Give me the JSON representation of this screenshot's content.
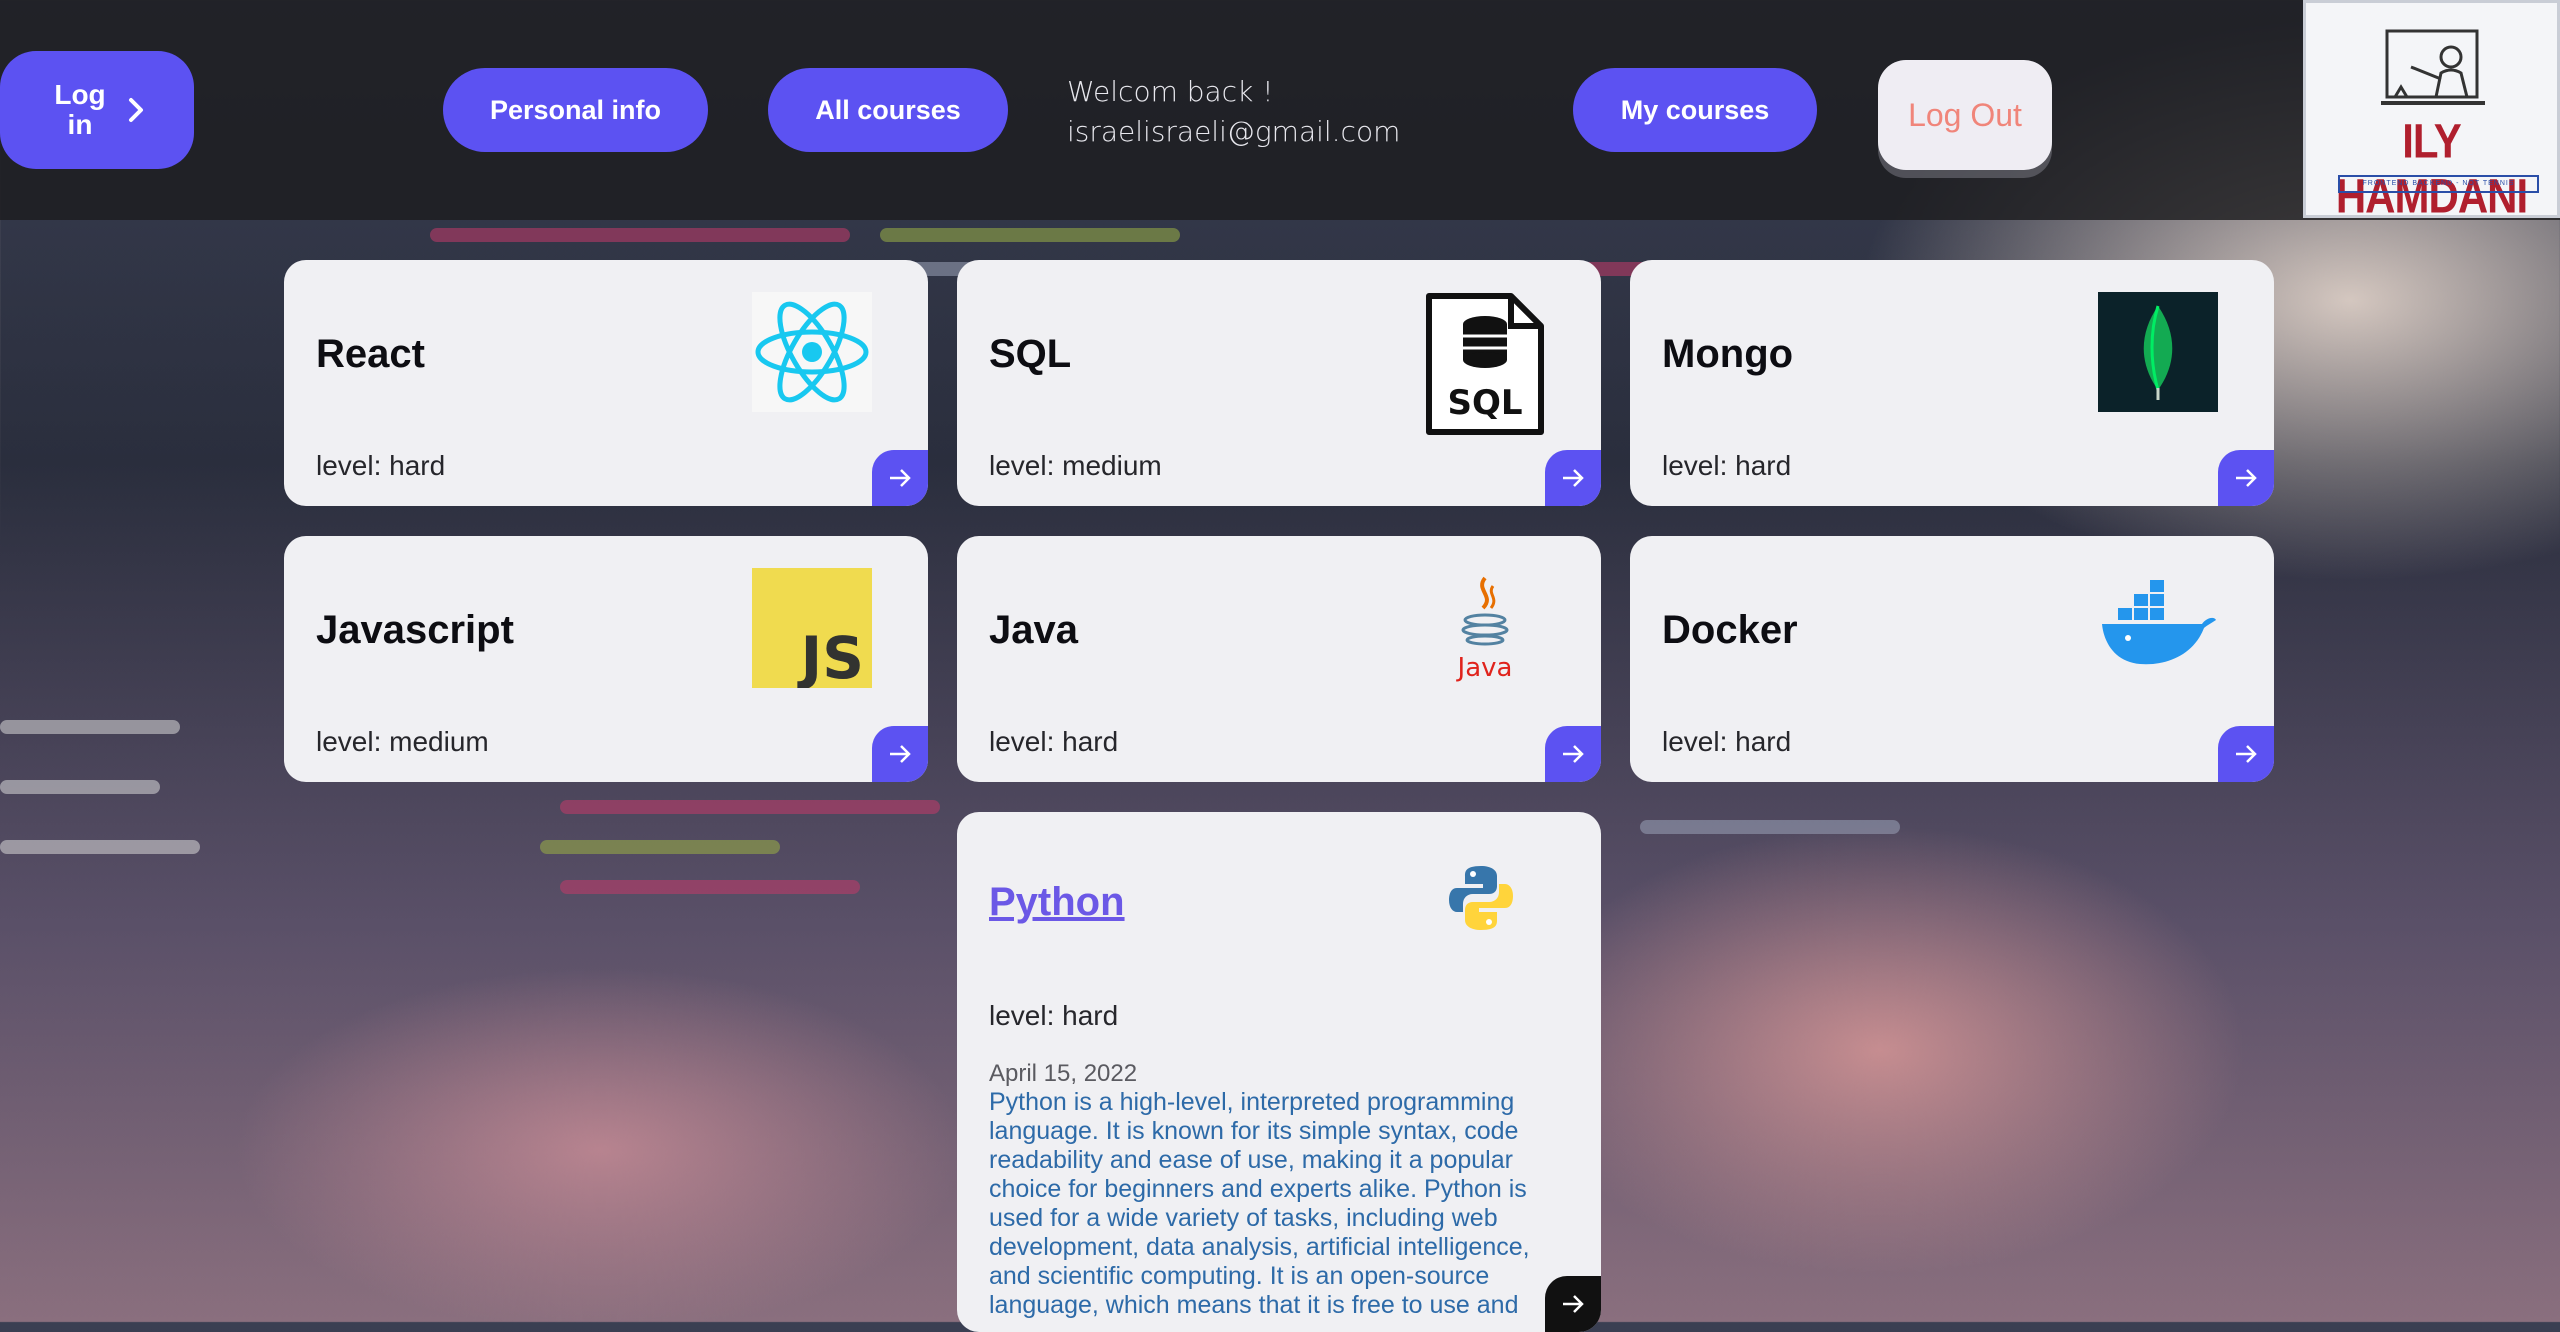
{
  "nav": {
    "login_label": "Log in",
    "personal_info_label": "Personal info",
    "all_courses_label": "All courses",
    "welcome_text": "Welcom back !",
    "user_email": "israelisraeli@gmail.com",
    "my_courses_label": "My courses",
    "logout_label": "Log Out"
  },
  "logo": {
    "title": "ILY HAMDANI",
    "subtitle": "FRONTEND BACKEND - NOT TENNIS"
  },
  "colors": {
    "accent": "#5c52f2",
    "logout_text": "#f0857a",
    "link_title": "#6b58e6",
    "description": "#2d6aa8"
  },
  "courses": [
    {
      "title": "React",
      "level": "level: hard",
      "icon": "react-icon"
    },
    {
      "title": "SQL",
      "level": "level: medium",
      "icon": "sql-file-icon"
    },
    {
      "title": "Mongo",
      "level": "level: hard",
      "icon": "mongodb-leaf-icon"
    },
    {
      "title": "Javascript",
      "level": "level: medium",
      "icon": "javascript-icon"
    },
    {
      "title": "Java",
      "level": "level: hard",
      "icon": "java-icon"
    },
    {
      "title": "Docker",
      "level": "level: hard",
      "icon": "docker-whale-icon"
    },
    {
      "title": "Python",
      "level": "level: hard",
      "icon": "python-icon",
      "date": "April 15, 2022",
      "description": "Python is a high-level, interpreted programming language. It is known for its simple syntax, code readability and ease of use, making it a popular choice for beginners and experts alike. Python is used for a wide variety of tasks, including web development, data analysis, artificial intelligence, and scientific computing. It is an open-source language, which means that it is free to use and"
    }
  ]
}
